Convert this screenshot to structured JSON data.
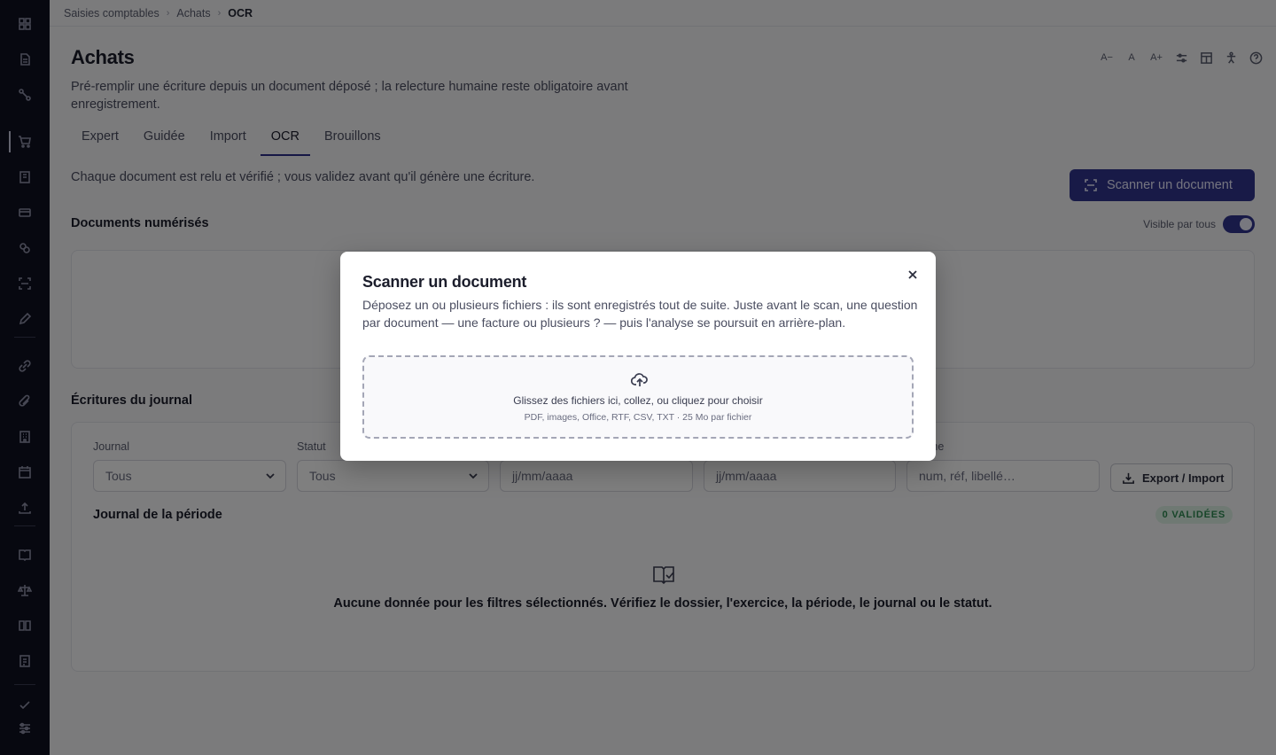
{
  "breadcrumb": {
    "items": [
      "Saisies comptables",
      "Achats"
    ],
    "current": "OCR"
  },
  "page": {
    "title": "Achats",
    "description": "Pré-remplir une écriture depuis un document déposé ; la relecture humaine reste obligatoire avant enregistrement."
  },
  "toolbar": {
    "font_smaller": "A−",
    "font_normal": "A",
    "font_larger": "A+"
  },
  "tabs": [
    {
      "label": "Expert"
    },
    {
      "label": "Guidée"
    },
    {
      "label": "Import"
    },
    {
      "label": "OCR"
    },
    {
      "label": "Brouillons"
    }
  ],
  "ocr": {
    "hint": "Chaque document est relu et vérifié ; vous validez avant qu'il génère une écriture.",
    "scan_button": "Scanner un document"
  },
  "documents": {
    "title": "Documents numérisés",
    "visibility_label": "Visible par tous"
  },
  "journal": {
    "title": "Écritures du journal",
    "filters": {
      "journal_label": "Journal",
      "journal_value": "Tous",
      "status_label": "Statut",
      "status_value": "Tous",
      "date_from_placeholder": "jj/mm/aaaa",
      "date_to_placeholder": "jj/mm/aaaa",
      "search_label": "rche",
      "search_placeholder": "num, réf, libellé…"
    },
    "export_button": "Export / Import",
    "period_title": "Journal de la période",
    "validated_badge": "0 VALIDÉES",
    "empty_message": "Aucune donnée pour les filtres sélectionnés. Vérifiez le dossier, l'exercice, la période, le journal ou le statut."
  },
  "modal": {
    "title": "Scanner un document",
    "description": "Déposez un ou plusieurs fichiers : ils sont enregistrés tout de suite. Juste avant le scan, une question par document — une facture ou plusieurs ? — puis l'analyse se poursuit en arrière-plan.",
    "drop_main": "Glissez des fichiers ici, collez, ou cliquez pour choisir",
    "drop_sub": "PDF, images, Office, RTF, CSV, TXT · 25 Mo par fichier"
  }
}
